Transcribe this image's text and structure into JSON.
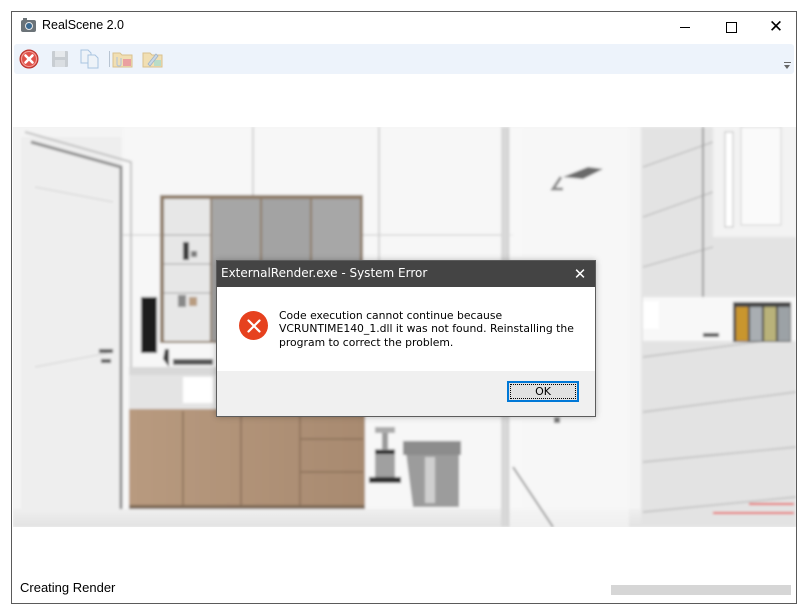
{
  "window": {
    "title": "RealScene 2.0",
    "controls": {
      "minimize_icon": "minimize-icon",
      "maximize_icon": "maximize-icon",
      "close_icon": "close-icon",
      "close_glyph": "✕"
    }
  },
  "toolbar": {
    "buttons": [
      {
        "name": "stop",
        "icon": "stop-icon",
        "enabled": true
      },
      {
        "name": "save",
        "icon": "save-icon",
        "enabled": false
      },
      {
        "name": "copy",
        "icon": "copy-icon",
        "enabled": false
      },
      {
        "name": "open-folder",
        "icon": "folder-attach-icon",
        "enabled": false
      },
      {
        "name": "export-folder",
        "icon": "folder-edit-icon",
        "enabled": false
      }
    ],
    "overflow_icon": "toolbar-overflow-icon"
  },
  "render_view": {
    "description": "Blurred bathroom interior render in progress",
    "watermark_color": "#e83a3a"
  },
  "status": {
    "text": "Creating Render",
    "progress_percent": 0
  },
  "dialog": {
    "title": "ExternalRender.exe - System Error",
    "close_glyph": "✕",
    "icon": "error-icon",
    "message": "Code execution cannot continue because VCRUNTIME140_1.dll it was not found. Reinstalling the program to correct the problem.",
    "ok_label": "OK",
    "error_color": "#e6411e",
    "focus_color": "#0078d7"
  }
}
